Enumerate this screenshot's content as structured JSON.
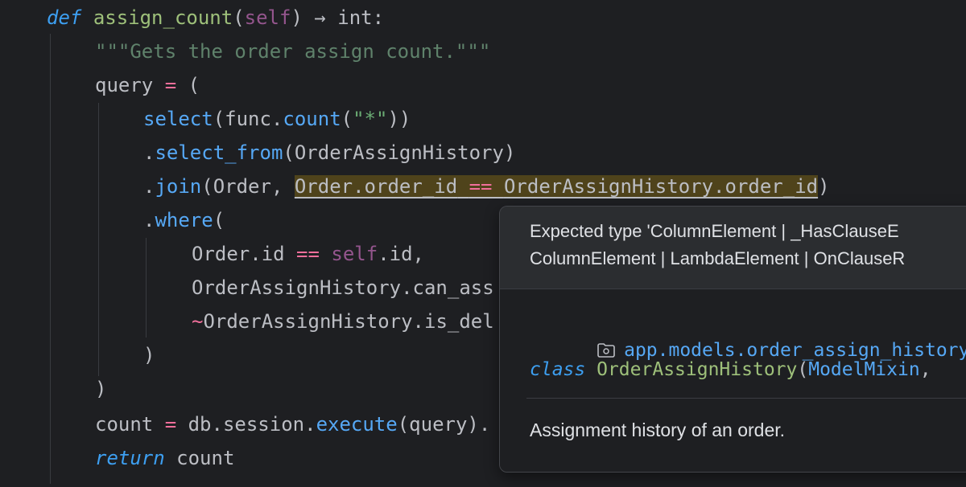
{
  "code": {
    "def_kw": "def",
    "func_name": "assign_count",
    "self_kw": "self",
    "arrow": "→",
    "ret_type": "int:",
    "docstring": "\"\"\"Gets the order assign count.\"\"\"",
    "query_var": "query",
    "eq": "=",
    "open_paren": "(",
    "select_fn": "select",
    "func_obj": "func",
    "count_fn": "count",
    "star_str": "\"*\"",
    "select_from_fn": "select_from",
    "history_cls": "OrderAssignHistory",
    "join_fn": "join",
    "order_cls": "Order",
    "join_condition_left": "Order.order_id",
    "join_eq": "==",
    "join_condition_right": "OrderAssignHistory.order_id",
    "where_fn": "where",
    "cond1_left": "Order.id",
    "cond1_op": "==",
    "cond1_self": "self",
    "cond1_attr": ".id,",
    "cond2": "OrderAssignHistory.can_ass",
    "cond3_tilde": "~",
    "cond3": "OrderAssignHistory.is_del",
    "close_paren": ")",
    "count_var": "count",
    "db_session": "db.session.",
    "execute_fn": "execute",
    "execute_arg": "(query).",
    "return_kw": "return",
    "return_val": "count"
  },
  "popup": {
    "error_line1": "Expected type 'ColumnElement | _HasClauseE",
    "error_line2": "ColumnElement | LambdaElement | OnClauseR",
    "module_icon": "folder-icon",
    "module_path": "app.models.order_assign_history",
    "class_kw": "class",
    "class_name": "OrderAssignHistory",
    "class_paren": "(",
    "class_base": "ModelMixin",
    "class_rest": ",",
    "doc": "Assignment history of an order."
  }
}
